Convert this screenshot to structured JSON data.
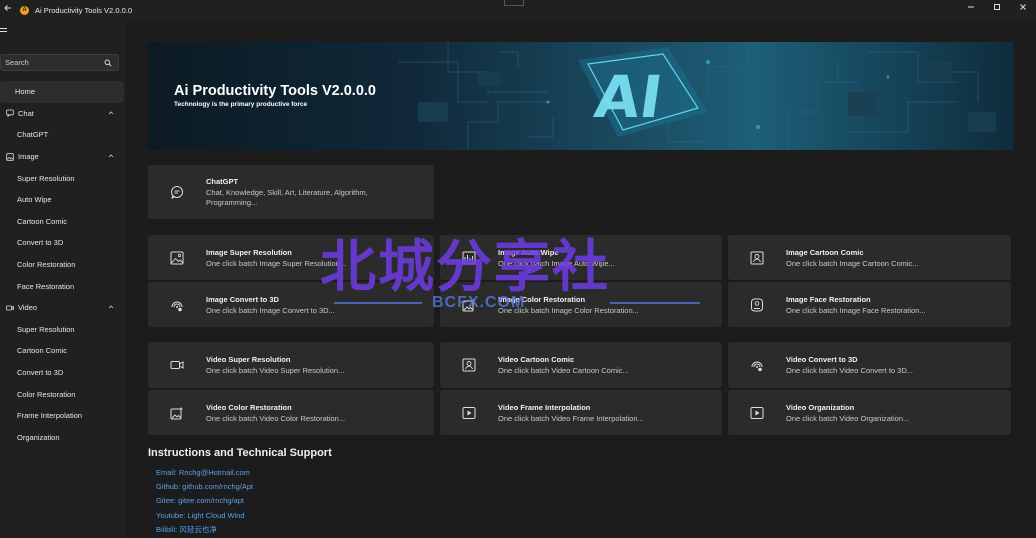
{
  "window": {
    "title": "Ai Productivity Tools V2.0.0.0",
    "controls": [
      "minimize",
      "maximize",
      "close"
    ]
  },
  "sidebar": {
    "search_placeholder": "Search",
    "items": [
      {
        "label": "Home",
        "level": "top",
        "selected": true,
        "icon": "home"
      },
      {
        "label": "Chat",
        "level": "top",
        "icon": "chat-icon",
        "expanded": true
      },
      {
        "label": "ChatGPT",
        "level": "sub"
      },
      {
        "label": "Image",
        "level": "top",
        "icon": "image-icon",
        "expanded": true
      },
      {
        "label": "Super Resolution",
        "level": "sub"
      },
      {
        "label": "Auto Wipe",
        "level": "sub"
      },
      {
        "label": "Cartoon Comic",
        "level": "sub"
      },
      {
        "label": "Convert to 3D",
        "level": "sub"
      },
      {
        "label": "Color Restoration",
        "level": "sub"
      },
      {
        "label": "Face Restoration",
        "level": "sub"
      },
      {
        "label": "Video",
        "level": "top",
        "icon": "video-icon",
        "expanded": true
      },
      {
        "label": "Super Resolution",
        "level": "sub"
      },
      {
        "label": "Cartoon Comic",
        "level": "sub"
      },
      {
        "label": "Convert to 3D",
        "level": "sub"
      },
      {
        "label": "Color Restoration",
        "level": "sub"
      },
      {
        "label": "Frame Interpolation",
        "level": "sub"
      },
      {
        "label": "Organization",
        "level": "sub"
      }
    ]
  },
  "banner": {
    "title": "Ai Productivity Tools V2.0.0.0",
    "subtitle": "Technology is the primary productive force",
    "image_text": "AI"
  },
  "chat_card": {
    "title": "ChatGPT",
    "desc_line1": "Chat, Knowledge, Skill, Art, Literature, Algorithm,",
    "desc_line2": "Programming..."
  },
  "image_cards": [
    {
      "title": "Image Super Resolution",
      "desc": "One click batch Image Super Resolution...",
      "icon": "image-icon"
    },
    {
      "title": "Image Auto Wipe",
      "desc": "One click batch Image Auto Wipe...",
      "icon": "wipe-icon"
    },
    {
      "title": "Image Cartoon Comic",
      "desc": "One click batch Image Cartoon Comic...",
      "icon": "portrait-icon"
    },
    {
      "title": "Image Convert to 3D",
      "desc": "One click batch Image Convert to 3D...",
      "icon": "3d-icon"
    },
    {
      "title": "Image Color Restoration",
      "desc": "One click batch Image Color Restoration...",
      "icon": "color-icon"
    },
    {
      "title": "Image Face Restoration",
      "desc": "One click batch Image Face Restoration...",
      "icon": "face-icon"
    }
  ],
  "video_cards": [
    {
      "title": "Video Super Resolution",
      "desc": "One click batch Video Super Resolution...",
      "icon": "video-camera-icon"
    },
    {
      "title": "Video Cartoon Comic",
      "desc": "One click batch Video Cartoon Comic...",
      "icon": "portrait-icon"
    },
    {
      "title": "Video Convert to 3D",
      "desc": "One click batch Video Convert to 3D...",
      "icon": "3d-icon"
    },
    {
      "title": "Video Color Restoration",
      "desc": "One click batch Video Color Restoration...",
      "icon": "color-icon"
    },
    {
      "title": "Video Frame Interpolation",
      "desc": "One click batch Video Frame Interpolation...",
      "icon": "play-icon"
    },
    {
      "title": "Video Organization",
      "desc": "One click batch Video Organization...",
      "icon": "play-icon"
    }
  ],
  "support": {
    "title": "Instructions and Technical Support",
    "links": [
      "Email: Rnchg@Hotmail.com",
      "Github: github.com/rnchg/Apt",
      "Gitee: gitee.com/rnchg/apt",
      "Youtube: Light Cloud Wind",
      "Bilibili: 风轻云也净"
    ]
  },
  "watermark": {
    "text": "北城分享社",
    "sub": "BCFX.COM"
  },
  "colors": {
    "background": "#202020",
    "card": "#2b2b2b",
    "link": "#5aa0e6",
    "accent": "#f0a020"
  }
}
